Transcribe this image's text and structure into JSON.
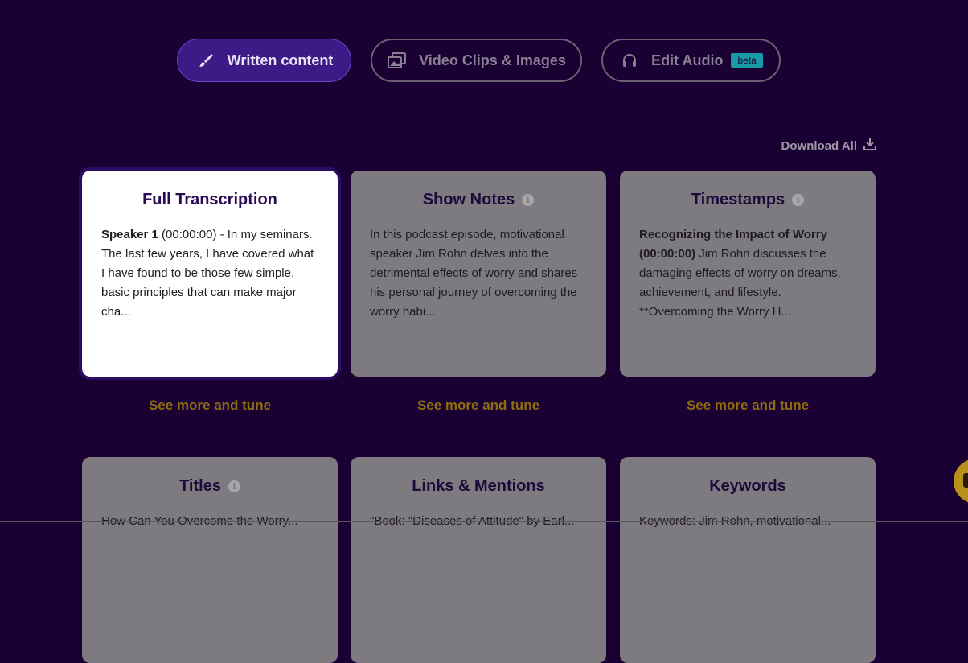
{
  "tabs": {
    "written": {
      "label": "Written content",
      "icon": "brush-icon"
    },
    "video": {
      "label": "Video Clips & Images",
      "icon": "images-icon"
    },
    "audio": {
      "label": "Edit Audio",
      "badge": "beta",
      "icon": "headphones-icon"
    }
  },
  "download_all": {
    "label": "Download All",
    "icon": "download-icon"
  },
  "cards": [
    {
      "title": "Full Transcription",
      "speaker": "Speaker 1",
      "text": " (00:00:00) - In my seminars. The last few years, I have covered what I have found to be those few simple, basic principles that can make major cha...",
      "more": "See more and tune"
    },
    {
      "title": "Show Notes",
      "text": "In this podcast episode, motivational speaker Jim Rohn delves into the detrimental effects of worry and shares his personal journey of overcoming the worry habi...",
      "more": "See more and tune"
    },
    {
      "title": "Timestamps",
      "bold": "Recognizing the Impact of Worry (00:00:00)",
      "text": " Jim Rohn discusses the damaging effects of worry on dreams, achievement, and lifestyle. **Overcoming the Worry H...",
      "more": "See more and tune"
    },
    {
      "title": "Titles",
      "text": "How Can You Overcome the Worry..."
    },
    {
      "title": "Links & Mentions",
      "text": "\"Book: \"Diseases of Attitude\" by Earl..."
    },
    {
      "title": "Keywords",
      "text": "Keywords: Jim Rohn, motivational..."
    }
  ],
  "colors": {
    "background": "#1b0033",
    "active_tab": "#3d1a86",
    "accent_link": "#8c6d10",
    "badge": "#1a9aa6"
  }
}
